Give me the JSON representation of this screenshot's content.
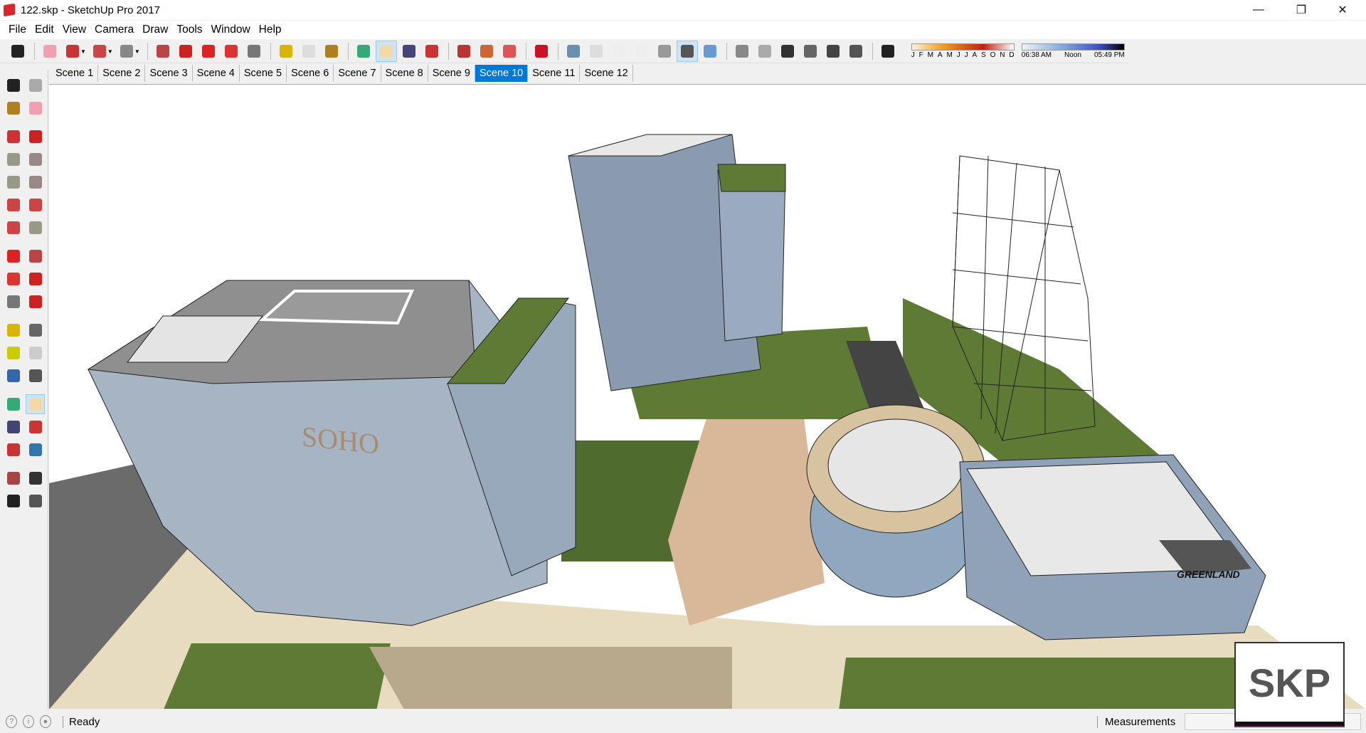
{
  "window": {
    "title": "122.skp - SketchUp Pro 2017",
    "controls": [
      "minimize",
      "restore",
      "close"
    ]
  },
  "menu": [
    "File",
    "Edit",
    "View",
    "Camera",
    "Draw",
    "Tools",
    "Window",
    "Help"
  ],
  "toolbar": {
    "groups": [
      [
        {
          "icon": "select-arrow-icon",
          "c": "#222"
        }
      ],
      [
        {
          "icon": "eraser-icon",
          "c": "#f0a0b0"
        },
        {
          "icon": "pencil-line-icon",
          "c": "#c33",
          "drop": true
        },
        {
          "icon": "arc-icon",
          "c": "#c44",
          "drop": true
        },
        {
          "icon": "rectangle-icon",
          "c": "#888",
          "drop": true
        }
      ],
      [
        {
          "icon": "push-pull-icon",
          "c": "#b44"
        },
        {
          "icon": "follow-me-icon",
          "c": "#c22"
        },
        {
          "icon": "move-icon",
          "c": "#d22"
        },
        {
          "icon": "rotate-icon",
          "c": "#d33"
        },
        {
          "icon": "scale-icon",
          "c": "#777"
        }
      ],
      [
        {
          "icon": "tape-measure-icon",
          "c": "#d9b400"
        },
        {
          "icon": "text-icon",
          "c": "#ddd"
        },
        {
          "icon": "paint-bucket-icon",
          "c": "#b08020"
        }
      ],
      [
        {
          "icon": "orbit-icon",
          "c": "#3a7"
        },
        {
          "icon": "pan-hand-icon",
          "c": "#f3d9a8",
          "active": true
        },
        {
          "icon": "zoom-icon",
          "c": "#447"
        },
        {
          "icon": "zoom-extents-icon",
          "c": "#c33"
        }
      ],
      [
        {
          "icon": "3d-warehouse-icon",
          "c": "#b33"
        },
        {
          "icon": "extension-warehouse-icon",
          "c": "#c63"
        },
        {
          "icon": "layout-send-icon",
          "c": "#d55"
        }
      ],
      [
        {
          "icon": "ruby-console-icon",
          "c": "#c12"
        }
      ],
      [
        {
          "icon": "xray-icon",
          "c": "#6a8fb0"
        },
        {
          "icon": "back-edges-icon",
          "c": "#ddd"
        },
        {
          "icon": "wireframe-icon",
          "c": "#eee"
        },
        {
          "icon": "hidden-line-icon",
          "c": "#eee"
        },
        {
          "icon": "shaded-icon",
          "c": "#999"
        },
        {
          "icon": "shaded-textures-icon",
          "c": "#555",
          "active": true
        },
        {
          "icon": "monochrome-icon",
          "c": "#6a9ad0"
        }
      ],
      [
        {
          "icon": "iso-view-icon",
          "c": "#888"
        },
        {
          "icon": "top-view-icon",
          "c": "#aaa"
        },
        {
          "icon": "front-view-icon",
          "c": "#333"
        },
        {
          "icon": "right-view-icon",
          "c": "#666"
        },
        {
          "icon": "back-view-icon",
          "c": "#444"
        },
        {
          "icon": "left-view-icon",
          "c": "#555"
        }
      ],
      [
        {
          "icon": "shadows-toggle-icon",
          "c": "#222"
        }
      ]
    ],
    "shadow": {
      "months": [
        "J",
        "F",
        "M",
        "A",
        "M",
        "J",
        "J",
        "A",
        "S",
        "O",
        "N",
        "D"
      ],
      "month_value": "M",
      "time_start": "06:38 AM",
      "time_mid": "Noon",
      "time_end": "05:49 PM",
      "time_value": "06:38 AM"
    }
  },
  "scenes": {
    "tabs": [
      "Scene 1",
      "Scene 2",
      "Scene 3",
      "Scene 4",
      "Scene 5",
      "Scene 6",
      "Scene 7",
      "Scene 8",
      "Scene 9",
      "Scene 10",
      "Scene 11",
      "Scene 12"
    ],
    "active": "Scene 10"
  },
  "left_tools": [
    [
      {
        "icon": "select-icon",
        "c": "#222"
      },
      {
        "icon": "make-component-icon",
        "c": "#aaa"
      }
    ],
    [
      {
        "icon": "paint-bucket-icon",
        "c": "#b08020"
      },
      {
        "icon": "eraser-icon",
        "c": "#f0a0b0"
      }
    ],
    [
      {
        "icon": "line-icon",
        "c": "#c33",
        "gap": true
      },
      {
        "icon": "freehand-icon",
        "c": "#c22"
      }
    ],
    [
      {
        "icon": "rectangle-icon",
        "c": "#998"
      },
      {
        "icon": "rotated-rectangle-icon",
        "c": "#988"
      }
    ],
    [
      {
        "icon": "circle-icon",
        "c": "#998"
      },
      {
        "icon": "polygon-icon",
        "c": "#988"
      }
    ],
    [
      {
        "icon": "arc-icon",
        "c": "#c44"
      },
      {
        "icon": "two-point-arc-icon",
        "c": "#c44"
      }
    ],
    [
      {
        "icon": "three-point-arc-icon",
        "c": "#c44"
      },
      {
        "icon": "pie-icon",
        "c": "#998"
      }
    ],
    [
      {
        "icon": "move-icon",
        "c": "#d22",
        "gap": true
      },
      {
        "icon": "push-pull-icon",
        "c": "#b44"
      }
    ],
    [
      {
        "icon": "rotate-icon",
        "c": "#d33"
      },
      {
        "icon": "follow-me-icon",
        "c": "#c22"
      }
    ],
    [
      {
        "icon": "scale-icon",
        "c": "#777"
      },
      {
        "icon": "offset-icon",
        "c": "#c22"
      }
    ],
    [
      {
        "icon": "tape-measure-icon",
        "c": "#d9b400",
        "gap": true
      },
      {
        "icon": "dimension-icon",
        "c": "#666"
      }
    ],
    [
      {
        "icon": "protractor-icon",
        "c": "#cc0"
      },
      {
        "icon": "text-icon",
        "c": "#ccc"
      }
    ],
    [
      {
        "icon": "axes-icon",
        "c": "#36a"
      },
      {
        "icon": "3d-text-icon",
        "c": "#555"
      }
    ],
    [
      {
        "icon": "orbit-icon",
        "c": "#3a7",
        "gap": true
      },
      {
        "icon": "pan-hand-icon",
        "c": "#f3d9a8",
        "active": true
      }
    ],
    [
      {
        "icon": "zoom-icon",
        "c": "#447"
      },
      {
        "icon": "zoom-window-icon",
        "c": "#c33"
      }
    ],
    [
      {
        "icon": "zoom-extents-icon",
        "c": "#c33"
      },
      {
        "icon": "previous-view-icon",
        "c": "#37a"
      }
    ],
    [
      {
        "icon": "position-camera-icon",
        "c": "#a44",
        "gap": true
      },
      {
        "icon": "look-around-icon",
        "c": "#333"
      }
    ],
    [
      {
        "icon": "walk-icon",
        "c": "#222"
      },
      {
        "icon": "section-plane-icon",
        "c": "#555"
      }
    ]
  ],
  "model_labels": {
    "building_a": "SOHO",
    "building_b": "GREENLAND"
  },
  "status": {
    "text": "Ready",
    "measurements_label": "Measurements",
    "measurements_value": ""
  },
  "watermark": "SKP"
}
